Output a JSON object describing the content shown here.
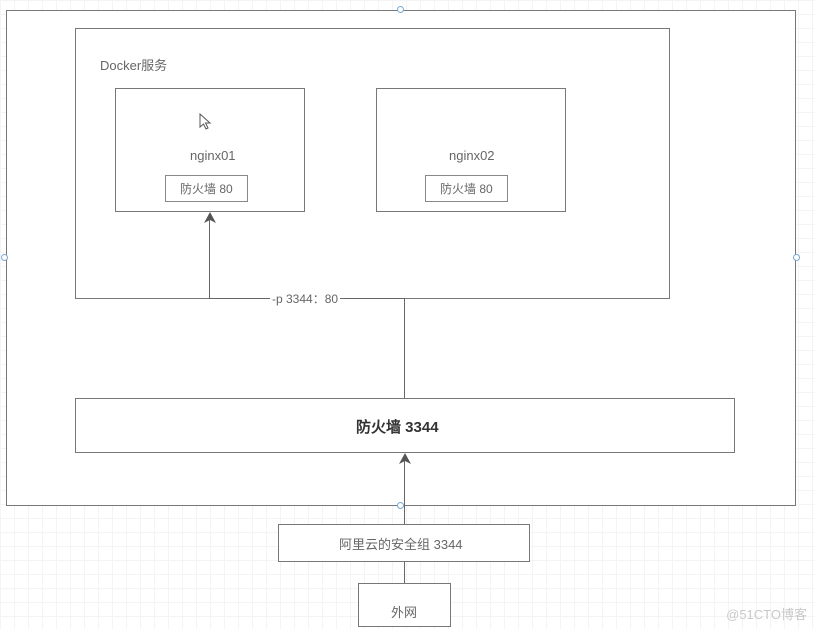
{
  "diagram": {
    "outer_box": {},
    "docker_group": {
      "label": "Docker服务",
      "nginx01": {
        "name": "nginx01",
        "firewall": "防火墙  80"
      },
      "nginx02": {
        "name": "nginx02",
        "firewall": "防火墙  80"
      }
    },
    "firewall_main": {
      "label": "防火墙   3344"
    },
    "aliyun_sg": {
      "label": "阿里云的安全组   3344"
    },
    "external": {
      "label": "外网"
    },
    "port_mapping": {
      "label": "-p 3344：80"
    }
  },
  "watermark": "@51CTO博客"
}
